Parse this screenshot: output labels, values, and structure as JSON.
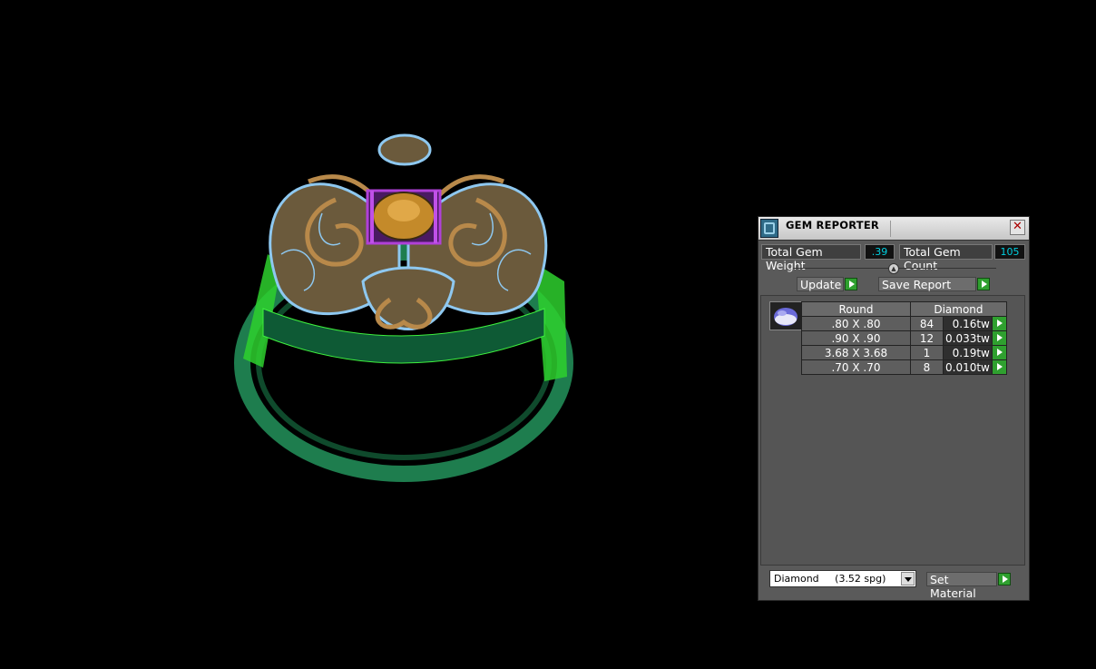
{
  "panel": {
    "title": "GEM REPORTER",
    "close_icon": "close-icon",
    "total_weight_label": "Total Gem Weight",
    "total_weight_value": ".39",
    "total_count_label": "Total Gem Count",
    "total_count_value": "105",
    "update_label": "Update",
    "save_report_label": "Save Report",
    "table": {
      "headers": [
        "Round",
        "Diamond"
      ],
      "rows": [
        {
          "size": ".80 X .80",
          "count": "84",
          "weight": "0.16tw"
        },
        {
          "size": ".90 X .90",
          "count": "12",
          "weight": "0.033tw"
        },
        {
          "size": "3.68 X 3.68",
          "count": "1",
          "weight": "0.19tw"
        },
        {
          "size": ".70 X .70",
          "count": "8",
          "weight": "0.010tw"
        }
      ]
    },
    "material_select_value": "Diamond     (3.52 spg)",
    "set_material_label": "Set Material"
  },
  "colors": {
    "ring_band": "#1f8a55",
    "ring_bright": "#3ef03e",
    "filigree_gold": "#b8894a",
    "pave_blue": "#8ec8f0",
    "center_prong": "#9a2ab8"
  }
}
